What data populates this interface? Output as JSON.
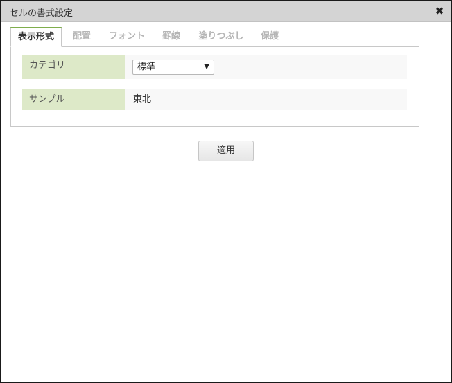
{
  "dialog": {
    "title": "セルの書式設定",
    "close_icon": "close-icon"
  },
  "tabs": [
    {
      "label": "表示形式",
      "active": true
    },
    {
      "label": "配置",
      "active": false
    },
    {
      "label": "フォント",
      "active": false
    },
    {
      "label": "罫線",
      "active": false
    },
    {
      "label": "塗りつぶし",
      "active": false
    },
    {
      "label": "保護",
      "active": false
    }
  ],
  "form": {
    "category_label": "カテゴリ",
    "category_value": "標準",
    "sample_label": "サンプル",
    "sample_value": "東北"
  },
  "buttons": {
    "apply_label": "適用"
  },
  "colors": {
    "titlebar": "#d4d4d4",
    "active_tab_accent": "#7fae4c",
    "label_bg": "#dde9c8"
  }
}
